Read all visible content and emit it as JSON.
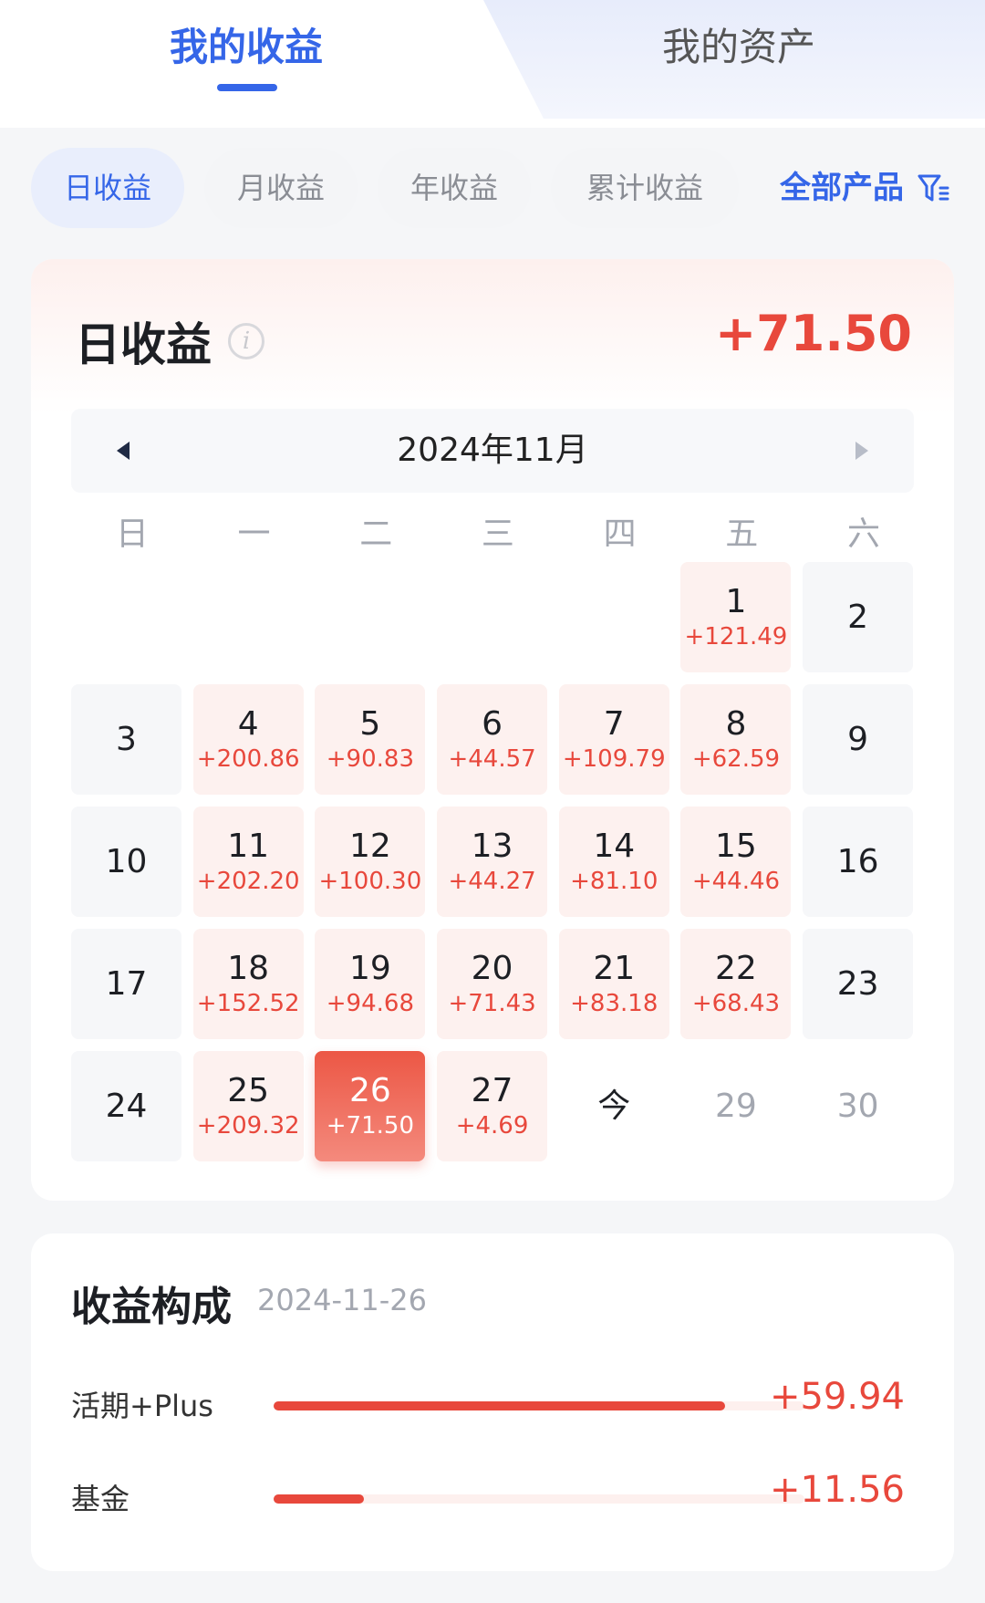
{
  "tabs": {
    "active": "我的收益",
    "inactive": "我的资产"
  },
  "filters": {
    "chips": [
      "日收益",
      "月收益",
      "年收益",
      "累计收益"
    ],
    "active_index": 0,
    "all_products": "全部产品",
    "filter_icon": "filter-icon"
  },
  "daily": {
    "title": "日收益",
    "info_icon": "info-icon",
    "total": "+71.50",
    "month": "2024年11月",
    "weekdays": [
      "日",
      "一",
      "二",
      "三",
      "四",
      "五",
      "六"
    ],
    "days": [
      {
        "d": "",
        "v": "",
        "state": "empty"
      },
      {
        "d": "",
        "v": "",
        "state": "empty"
      },
      {
        "d": "",
        "v": "",
        "state": "empty"
      },
      {
        "d": "",
        "v": "",
        "state": "empty"
      },
      {
        "d": "",
        "v": "",
        "state": "empty"
      },
      {
        "d": "1",
        "v": "+121.49",
        "state": "gain"
      },
      {
        "d": "2",
        "v": "",
        "state": "plain"
      },
      {
        "d": "3",
        "v": "",
        "state": "plain"
      },
      {
        "d": "4",
        "v": "+200.86",
        "state": "gain"
      },
      {
        "d": "5",
        "v": "+90.83",
        "state": "gain"
      },
      {
        "d": "6",
        "v": "+44.57",
        "state": "gain"
      },
      {
        "d": "7",
        "v": "+109.79",
        "state": "gain"
      },
      {
        "d": "8",
        "v": "+62.59",
        "state": "gain"
      },
      {
        "d": "9",
        "v": "",
        "state": "plain"
      },
      {
        "d": "10",
        "v": "",
        "state": "plain"
      },
      {
        "d": "11",
        "v": "+202.20",
        "state": "gain"
      },
      {
        "d": "12",
        "v": "+100.30",
        "state": "gain"
      },
      {
        "d": "13",
        "v": "+44.27",
        "state": "gain"
      },
      {
        "d": "14",
        "v": "+81.10",
        "state": "gain"
      },
      {
        "d": "15",
        "v": "+44.46",
        "state": "gain"
      },
      {
        "d": "16",
        "v": "",
        "state": "plain"
      },
      {
        "d": "17",
        "v": "",
        "state": "plain"
      },
      {
        "d": "18",
        "v": "+152.52",
        "state": "gain"
      },
      {
        "d": "19",
        "v": "+94.68",
        "state": "gain"
      },
      {
        "d": "20",
        "v": "+71.43",
        "state": "gain"
      },
      {
        "d": "21",
        "v": "+83.18",
        "state": "gain"
      },
      {
        "d": "22",
        "v": "+68.43",
        "state": "gain"
      },
      {
        "d": "23",
        "v": "",
        "state": "plain"
      },
      {
        "d": "24",
        "v": "",
        "state": "plain"
      },
      {
        "d": "25",
        "v": "+209.32",
        "state": "gain"
      },
      {
        "d": "26",
        "v": "+71.50",
        "state": "selected"
      },
      {
        "d": "27",
        "v": "+4.69",
        "state": "gain"
      },
      {
        "d": "今",
        "v": "",
        "state": "today"
      },
      {
        "d": "29",
        "v": "",
        "state": "future"
      },
      {
        "d": "30",
        "v": "",
        "state": "future"
      }
    ]
  },
  "composition": {
    "title": "收益构成",
    "date": "2024-11-26",
    "items": [
      {
        "label": "活期+Plus",
        "amount": "+59.94",
        "share": 0.85
      },
      {
        "label": "基金",
        "amount": "+11.56",
        "share": 0.17
      }
    ]
  },
  "colors": {
    "accent_blue": "#3566e8",
    "gain_red": "#e8483c"
  }
}
